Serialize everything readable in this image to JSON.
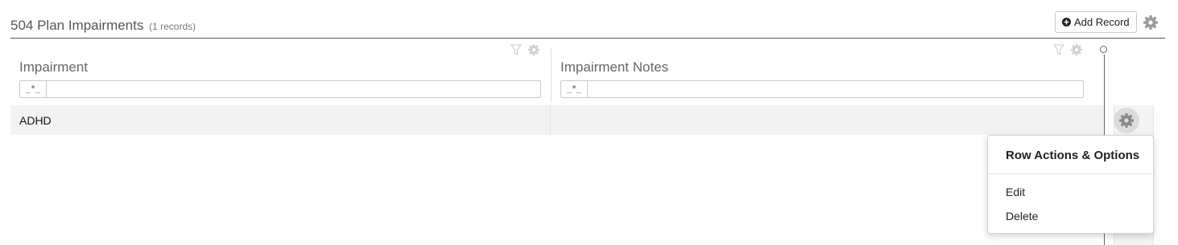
{
  "header": {
    "title": "504 Plan Impairments",
    "record_count": "(1 records)",
    "add_button_label": "Add Record"
  },
  "columns": [
    {
      "label": "Impairment",
      "filter_mode": "_*_",
      "filter_value": ""
    },
    {
      "label": "Impairment Notes",
      "filter_mode": "_*_",
      "filter_value": ""
    }
  ],
  "rows": [
    {
      "impairment": "ADHD",
      "notes": ""
    }
  ],
  "row_menu": {
    "title": "Row Actions & Options",
    "items": [
      "Edit",
      "Delete"
    ]
  },
  "icons": {
    "add": "plus-circle-icon",
    "settings": "gear-icon",
    "filter": "filter-icon"
  },
  "colors": {
    "icon_gray": "#b5b5b5",
    "row_bg": "#f2f2f2",
    "text": "#333333"
  }
}
